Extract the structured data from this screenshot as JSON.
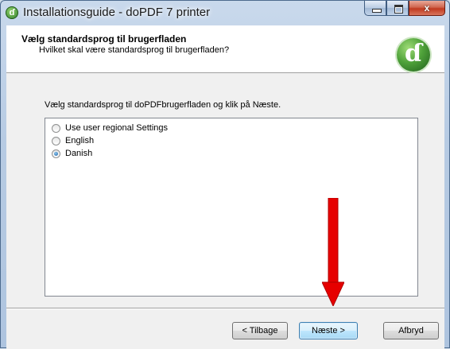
{
  "window": {
    "title": "Installationsguide - doPDF 7 printer",
    "close_glyph": "x"
  },
  "header": {
    "title": "Vælg standardsprog til brugerfladen",
    "subtitle": "Hvilket skal være standardsprog til brugerfladen?"
  },
  "main": {
    "instruction": "Vælg standardsprog til doPDFbrugerfladen og klik på Næste.",
    "options": [
      {
        "label": "Use user regional Settings",
        "checked": false
      },
      {
        "label": "English",
        "checked": false
      },
      {
        "label": "Danish",
        "checked": true
      }
    ]
  },
  "footer": {
    "back_label": "< Tilbage",
    "next_label": "Næste >",
    "cancel_label": "Afbryd"
  },
  "annotation": {
    "arrow_color": "#e60000"
  }
}
